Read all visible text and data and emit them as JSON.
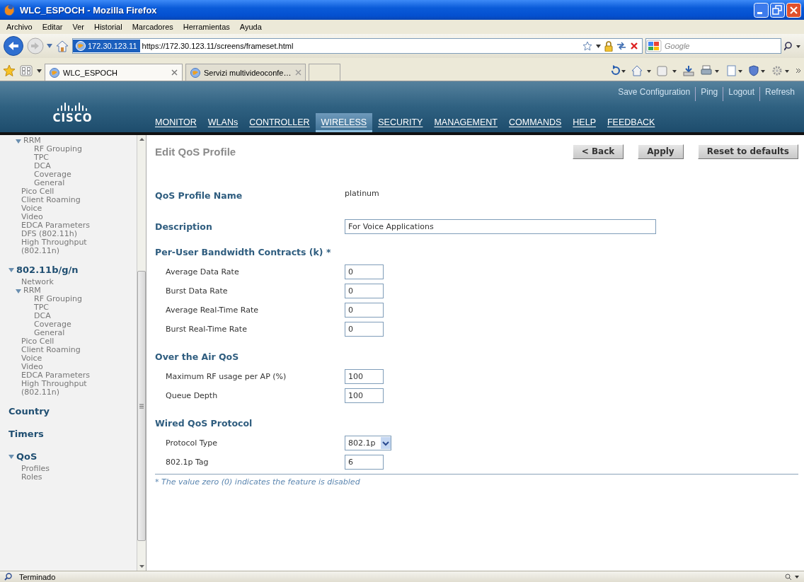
{
  "window": {
    "title": "WLC_ESPOCH - Mozilla Firefox"
  },
  "menu_bar": [
    "Archivo",
    "Editar",
    "Ver",
    "Historial",
    "Marcadores",
    "Herramientas",
    "Ayuda"
  ],
  "address_bar": {
    "site_identity": "172.30.123.11",
    "url": "https://172.30.123.11/screens/frameset.html"
  },
  "search_box": {
    "placeholder": "Google"
  },
  "tabs": [
    {
      "label": "WLC_ESPOCH",
      "selected": true
    },
    {
      "label": "Servizi multivideoconfe…",
      "selected": false
    }
  ],
  "header": {
    "logo": "CISCO",
    "top_links": [
      "Save Configuration",
      "Ping",
      "Logout",
      "Refresh"
    ],
    "nav": [
      {
        "label": "MONITOR",
        "selected": false
      },
      {
        "label": "WLANs",
        "selected": false
      },
      {
        "label": "CONTROLLER",
        "selected": false
      },
      {
        "label": "WIRELESS",
        "selected": true
      },
      {
        "label": "SECURITY",
        "selected": false
      },
      {
        "label": "MANAGEMENT",
        "selected": false
      },
      {
        "label": "COMMANDS",
        "selected": false
      },
      {
        "label": "HELP",
        "selected": false
      },
      {
        "label": "FEEDBACK",
        "selected": false
      }
    ]
  },
  "sidebar": {
    "items": [
      {
        "label": "RRM",
        "kind": "item",
        "expanded": true,
        "children": [
          {
            "label": "RF Grouping",
            "kind": "item"
          },
          {
            "label": "TPC",
            "kind": "item"
          },
          {
            "label": "DCA",
            "kind": "item"
          },
          {
            "label": "Coverage",
            "kind": "item"
          },
          {
            "label": "General",
            "kind": "item"
          }
        ]
      },
      {
        "label": "Pico Cell",
        "kind": "item"
      },
      {
        "label": "Client Roaming",
        "kind": "item"
      },
      {
        "label": "Voice",
        "kind": "item"
      },
      {
        "label": "Video",
        "kind": "item"
      },
      {
        "label": "EDCA Parameters",
        "kind": "item"
      },
      {
        "label": "DFS (802.11h)",
        "kind": "item"
      },
      {
        "label": "High Throughput (802.11n)",
        "kind": "item"
      },
      {
        "label": "802.11b/g/n",
        "kind": "section",
        "expanded": true,
        "children": [
          {
            "label": "Network",
            "kind": "item"
          },
          {
            "label": "RRM",
            "kind": "item",
            "expanded": true,
            "children": [
              {
                "label": "RF Grouping",
                "kind": "item"
              },
              {
                "label": "TPC",
                "kind": "item"
              },
              {
                "label": "DCA",
                "kind": "item"
              },
              {
                "label": "Coverage",
                "kind": "item"
              },
              {
                "label": "General",
                "kind": "item"
              }
            ]
          },
          {
            "label": "Pico Cell",
            "kind": "item"
          },
          {
            "label": "Client Roaming",
            "kind": "item"
          },
          {
            "label": "Voice",
            "kind": "item"
          },
          {
            "label": "Video",
            "kind": "item"
          },
          {
            "label": "EDCA Parameters",
            "kind": "item"
          },
          {
            "label": "High Throughput (802.11n)",
            "kind": "item"
          }
        ]
      },
      {
        "label": "Country",
        "kind": "section"
      },
      {
        "label": "Timers",
        "kind": "section"
      },
      {
        "label": "QoS",
        "kind": "section",
        "expanded": true,
        "children": [
          {
            "label": "Profiles",
            "kind": "item"
          },
          {
            "label": "Roles",
            "kind": "item"
          }
        ]
      }
    ]
  },
  "page": {
    "title": "Edit QoS Profile",
    "buttons": [
      "< Back",
      "Apply",
      "Reset to defaults"
    ],
    "profile_name": {
      "label": "QoS Profile Name",
      "value": "platinum"
    },
    "description": {
      "label": "Description",
      "value": "For Voice Applications"
    },
    "sections": [
      {
        "title": "Per-User Bandwidth Contracts (k) *",
        "fields": [
          {
            "label": "Average Data Rate",
            "kind": "text",
            "value": "0"
          },
          {
            "label": "Burst Data Rate",
            "kind": "text",
            "value": "0"
          },
          {
            "label": "Average Real-Time Rate",
            "kind": "text",
            "value": "0"
          },
          {
            "label": "Burst Real-Time Rate",
            "kind": "text",
            "value": "0"
          }
        ]
      },
      {
        "title": "Over the Air QoS",
        "fields": [
          {
            "label": "Maximum RF usage per AP (%)",
            "kind": "text",
            "value": "100"
          },
          {
            "label": "Queue Depth",
            "kind": "text",
            "value": "100"
          }
        ]
      },
      {
        "title": "Wired QoS Protocol",
        "fields": [
          {
            "label": "Protocol Type",
            "kind": "select",
            "value": "802.1p"
          },
          {
            "label": "802.1p Tag",
            "kind": "text",
            "value": "6"
          }
        ]
      }
    ],
    "footnote": "* The value zero (0) indicates the feature is disabled"
  },
  "status_bar": {
    "text": "Terminado"
  }
}
